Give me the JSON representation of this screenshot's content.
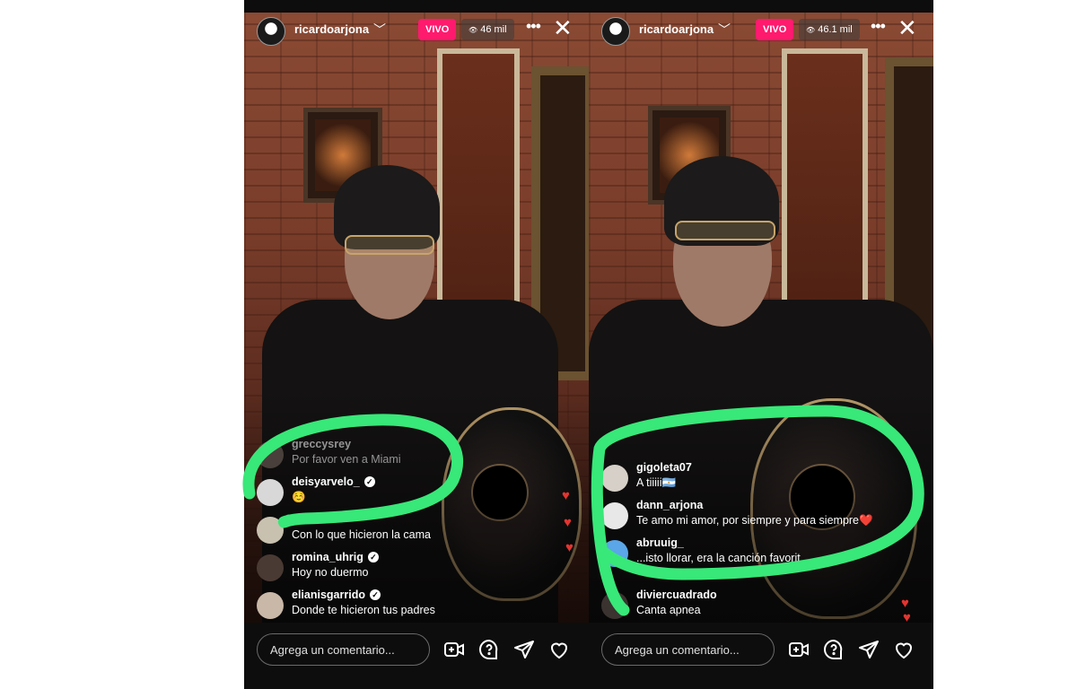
{
  "colors": {
    "live": "#ff1a6e",
    "annotation": "#38e878",
    "heart": "#e3342f"
  },
  "panels": [
    {
      "username": "ricardoarjona",
      "live_label": "VIVO",
      "viewers": "46 mil",
      "comments": [
        {
          "user": "greccysrey",
          "text": "Por favor ven a Miami",
          "verified": false,
          "faded": true
        },
        {
          "user": "deisyarvelo_",
          "text": "☺️",
          "verified": true,
          "faded": false
        },
        {
          "user": "",
          "text": "Con lo que hicieron la cama",
          "verified": false,
          "faded": false
        },
        {
          "user": "romina_uhrig",
          "text": "Hoy no duermo",
          "verified": true,
          "faded": false
        },
        {
          "user": "elianisgarrido",
          "text": "Donde te hicieron tus padres",
          "verified": true,
          "faded": false
        }
      ],
      "input_placeholder": "Agrega un comentario..."
    },
    {
      "username": "ricardoarjona",
      "live_label": "VIVO",
      "viewers": "46.1 mil",
      "comments": [
        {
          "user": "gigoleta07",
          "text": "A tiiiii🇦🇷",
          "verified": false,
          "faded": false
        },
        {
          "user": "dann_arjona",
          "text": "Te amo mi amor, por siempre y para siempre❤️",
          "verified": false,
          "faded": false
        },
        {
          "user": "abruuig_",
          "text": "...isto llorar, era la canción favorit...",
          "verified": false,
          "faded": false
        },
        {
          "user": "diviercuadrado",
          "text": "Canta apnea",
          "verified": false,
          "faded": false
        }
      ],
      "input_placeholder": "Agrega un comentario..."
    }
  ],
  "icons": {
    "add_guest": "video-plus-icon",
    "question": "question-icon",
    "share": "send-icon",
    "like": "heart-icon",
    "dropdown": "chevron-down-icon",
    "more": "more-horizontal-icon",
    "close": "close-icon",
    "viewers": "eye-icon"
  },
  "glyphs": {
    "chevron": "﹀",
    "more": "•••",
    "close": "✕",
    "eye": "👁",
    "verified": "✓",
    "heart": "♥"
  }
}
